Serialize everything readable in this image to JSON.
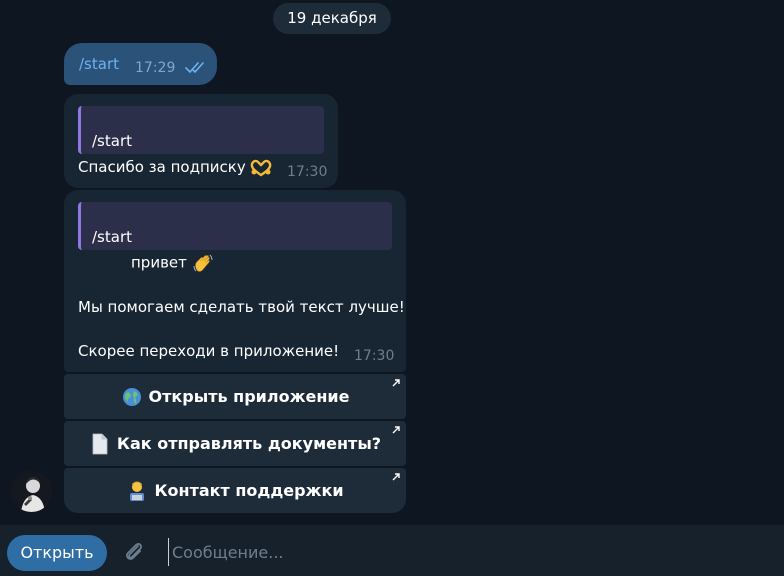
{
  "date_separator": "19 декабря",
  "outgoing": {
    "text": "/start",
    "time": "17:29",
    "status_icon": "double-check-icon"
  },
  "messages": [
    {
      "reply_text": "/start",
      "text": "Спасибо за подписку",
      "emoji": "heart-hands-emoji",
      "time": "17:30"
    },
    {
      "reply_text": "/start",
      "greeting": "привет",
      "greeting_emoji": "waving-hand-emoji",
      "line2": "Мы помогаем сделать твой текст лучше!",
      "line3": "Скорее переходи в приложение!",
      "time": "17:30"
    }
  ],
  "keyboard": [
    {
      "label": "Открыть приложение",
      "icon": "globe-icon"
    },
    {
      "label": "Как отправлять документы?",
      "icon": "document-icon"
    },
    {
      "label": "Контакт поддержки",
      "icon": "technologist-icon"
    }
  ],
  "composer": {
    "open_button": "Открыть",
    "placeholder": "Сообщение..."
  },
  "colors": {
    "background": "#0e1621",
    "incoming_bubble": "#182533",
    "outgoing_bubble": "#2b5278",
    "accent": "#2f6ea5",
    "reply_bar": "#8e78e6"
  }
}
